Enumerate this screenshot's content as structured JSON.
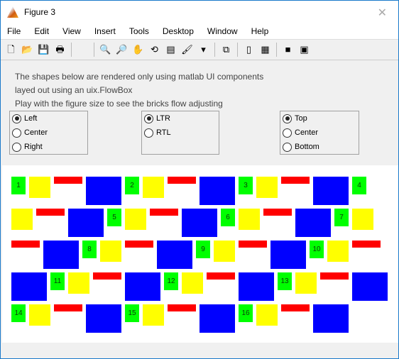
{
  "window": {
    "title": "Figure 3"
  },
  "menu": [
    "File",
    "Edit",
    "View",
    "Insert",
    "Tools",
    "Desktop",
    "Window",
    "Help"
  ],
  "toolbar": [
    {
      "icon": "new-file-icon",
      "glyph": "🗋"
    },
    {
      "icon": "open-folder-icon",
      "glyph": "📂"
    },
    {
      "icon": "save-icon",
      "glyph": "💾"
    },
    {
      "icon": "print-icon",
      "glyph": "🖶"
    },
    "sep",
    {
      "icon": "pointer-icon",
      "glyph": ""
    },
    "sep",
    {
      "icon": "zoom-in-icon",
      "glyph": "🔍"
    },
    {
      "icon": "zoom-out-icon",
      "glyph": "🔎"
    },
    {
      "icon": "pan-hand-icon",
      "glyph": "✋"
    },
    {
      "icon": "rotate-3d-icon",
      "glyph": "⟲"
    },
    {
      "icon": "data-cursor-icon",
      "glyph": "▤"
    },
    {
      "icon": "brush-icon",
      "glyph": "🖌"
    },
    {
      "icon": "dropdown-arrow-icon",
      "glyph": "▾"
    },
    "sep",
    {
      "icon": "link-plot-icon",
      "glyph": "⧉"
    },
    "sep",
    {
      "icon": "colorbar-icon",
      "glyph": "▯"
    },
    {
      "icon": "legend-icon",
      "glyph": "▦"
    },
    "sep",
    {
      "icon": "hide-plot-tools-icon",
      "glyph": "■"
    },
    {
      "icon": "show-plot-tools-icon",
      "glyph": "▣"
    }
  ],
  "description": [
    "The shapes below are rendered only using matlab UI components",
    "layed out using an uix.FlowBox",
    "Play with the figure size to see the bricks flow adjusting"
  ],
  "panels": [
    {
      "options": [
        "Left",
        "Center",
        "Right"
      ],
      "selected": 0
    },
    {
      "options": [
        "LTR",
        "RTL"
      ],
      "selected": 0
    },
    {
      "options": [
        "Top",
        "Center",
        "Bottom"
      ],
      "selected": 0
    }
  ],
  "colors": {
    "green": "#00ff00",
    "yellow": "#ffff00",
    "red": "#ff0000",
    "blue": "#0000ff"
  },
  "bricks": [
    "1",
    "2",
    "3",
    "4",
    "5",
    "6",
    "7",
    "8",
    "9",
    "10",
    "11",
    "12",
    "13",
    "14",
    "15",
    "16"
  ]
}
